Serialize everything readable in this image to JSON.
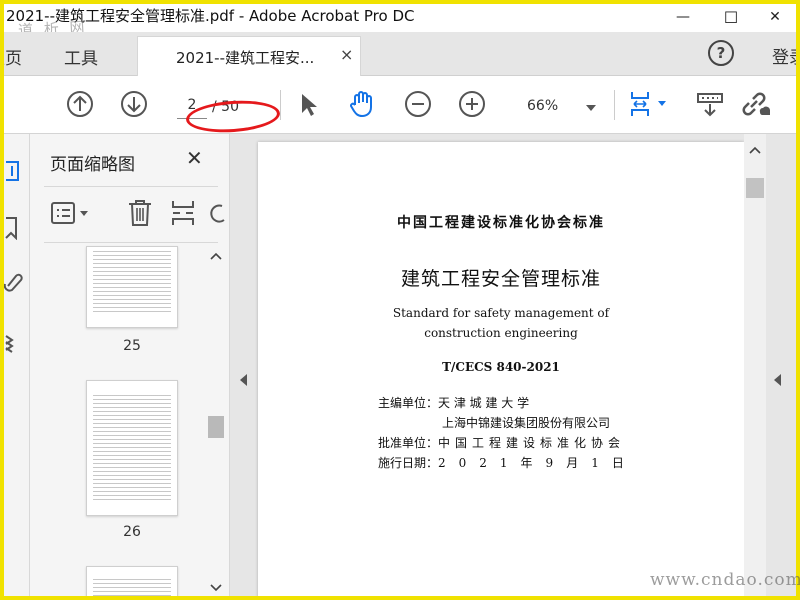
{
  "window": {
    "title": "2021--建筑工程安全管理标准.pdf - Adobe Acrobat Pro DC",
    "minimize_glyph": "—",
    "maximize_glyph": "☐",
    "close_glyph": "✕"
  },
  "tabs": {
    "home_label": "主页",
    "tools_label": "工具",
    "doc_tab_label": "2021--建筑工程安...",
    "doc_tab_close": "×",
    "help_glyph": "?",
    "login_label": "登录"
  },
  "toolbar": {
    "page_current": "2",
    "page_total": "/ 50",
    "zoom": "66%",
    "icons": [
      "prev-page-icon",
      "next-page-icon",
      "select-cursor-icon",
      "hand-tool-icon",
      "zoom-out-icon",
      "zoom-in-icon",
      "fit-page-icon",
      "scroll-mode-icon",
      "share-link-icon"
    ]
  },
  "thumbnails_panel": {
    "title": "页面缩略图",
    "close_glyph": "✕",
    "pages": [
      {
        "number": "25"
      },
      {
        "number": "26"
      }
    ]
  },
  "document": {
    "org_heading": "中国工程建设标准化协会标准",
    "title_cn": "建筑工程安全管理标准",
    "title_en_line1": "Standard for safety management of",
    "title_en_line2": "construction engineering",
    "code": "T/CECS 840-2021",
    "editor_label": "主编单位：",
    "editor_1": "天  津  城  建  大  学",
    "editor_2": "上海中锦建设集团股份有限公司",
    "approver_label": "批准单位：",
    "approver": "中国工程建设标准化协会",
    "date_label": "施行日期：",
    "date": "2021年9月1日"
  },
  "watermarks": {
    "top_left": "道 析 网",
    "bottom_right": "www.cndao.com"
  },
  "colors": {
    "highlight_ellipse": "#e5191c",
    "hand_tool_active": "#1473e6",
    "fit_icon": "#1473e6"
  }
}
